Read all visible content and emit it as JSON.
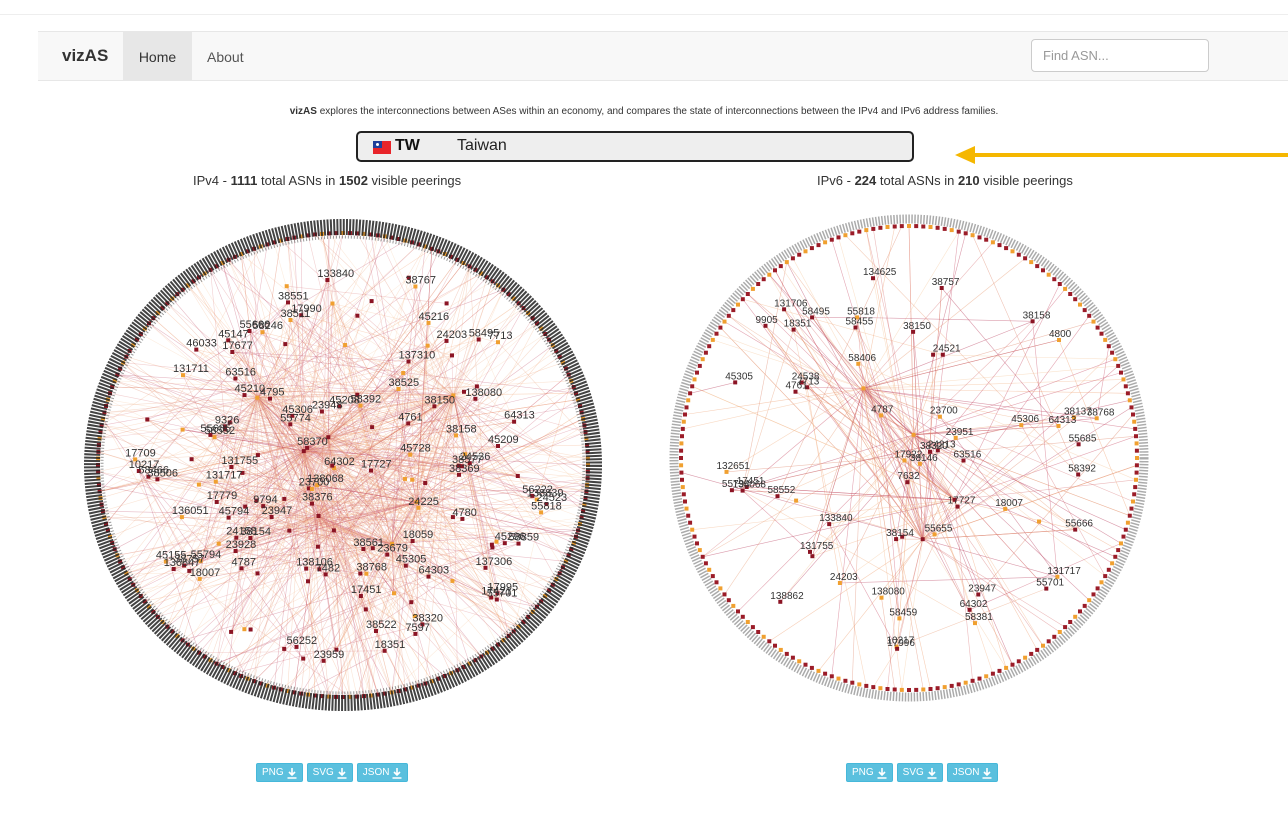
{
  "navbar": {
    "brand": "vizAS",
    "items": [
      "Home",
      "About"
    ],
    "search_placeholder": "Find ASN..."
  },
  "intro": {
    "bold": "vizAS",
    "text": " explores the interconnections between ASes within an economy, and compares the state of interconnections between the IPv4 and IPv6 address families."
  },
  "economy": {
    "code": "TW",
    "name": "Taiwan",
    "flag_colors": [
      "#e8242a",
      "#1f3f9a",
      "#ffffff"
    ]
  },
  "annotation_arrow_color": "#f5b700",
  "ipv4": {
    "prefix": "IPv4 - ",
    "asns": "1111",
    "mid": " total ASNs in ",
    "peerings": "1502",
    "suffix": " visible peerings",
    "labels": [
      "7713",
      "4780",
      "4761",
      "4787",
      "4795",
      "17421",
      "23947",
      "131755",
      "137306",
      "138106",
      "138839",
      "7597",
      "9794",
      "9326",
      "17990",
      "24225",
      "23700",
      "24536",
      "17677",
      "38150",
      "23928",
      "18007",
      "24158",
      "38561",
      "23948",
      "38522",
      "38767",
      "58495",
      "38511",
      "17709",
      "7482",
      "45305",
      "45147",
      "18351",
      "38158",
      "58552",
      "55818",
      "38757",
      "55685",
      "45296",
      "38525",
      "45728",
      "55666",
      "46033",
      "38320",
      "55701",
      "24523",
      "38506",
      "58392",
      "64302",
      "17451",
      "38369",
      "23679",
      "45208",
      "17995",
      "58370",
      "38376",
      "45794",
      "64313",
      "55794",
      "56252",
      "58246",
      "38768",
      "56222",
      "17727",
      "18059",
      "45209",
      "38154",
      "58466",
      "131717",
      "58859",
      "63516",
      "24203",
      "136847",
      "137310",
      "136051",
      "133840",
      "10217",
      "131711",
      "138068",
      "138080",
      "45210",
      "38551",
      "17779",
      "45216",
      "38577",
      "45155",
      "55774",
      "45306",
      "64303",
      "23959"
    ]
  },
  "ipv6": {
    "prefix": "IPv6 - ",
    "asns": "224",
    "mid": " total ASNs in ",
    "peerings": "210",
    "suffix": " visible peerings",
    "labels": [
      "138862",
      "9905",
      "10217",
      "134625",
      "7632",
      "17727",
      "138080",
      "4800",
      "17922",
      "133840",
      "23700",
      "132651",
      "131755",
      "138068",
      "4787",
      "4761",
      "18007",
      "17996",
      "24203",
      "63516",
      "18351",
      "24213",
      "7713",
      "131717",
      "24521",
      "23947",
      "58392",
      "64302",
      "38146",
      "55818",
      "58552",
      "131706",
      "17451",
      "23951",
      "58381",
      "58455",
      "38137",
      "55666",
      "58406",
      "38158",
      "24538",
      "38150",
      "55685",
      "55701",
      "38154",
      "58495",
      "64313",
      "45305",
      "55655",
      "55794",
      "38320",
      "45306",
      "38768",
      "38757",
      "58459"
    ]
  },
  "download_buttons": [
    "PNG",
    "SVG",
    "JSON"
  ]
}
